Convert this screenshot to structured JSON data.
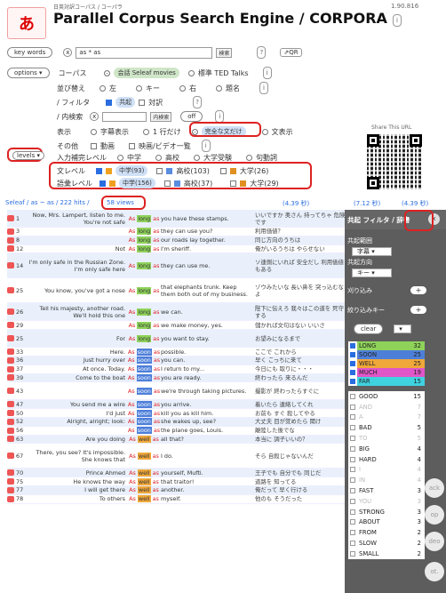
{
  "header": {
    "subtitle": "日英対訳コーパス / コーパラ",
    "title": "Parallel Corpus Search Engine / CORPORA",
    "version": "1.90.816",
    "logo": "あ"
  },
  "search": {
    "keywords_label": "key words",
    "query": "as * as",
    "search_btn": "検索",
    "qr_label": "QR",
    "help": "?",
    "clear": "x"
  },
  "options": {
    "label": "options",
    "corpus_label": "コーパス",
    "corpus_1": "会話 Seleaf movies",
    "corpus_2": "標準 TED Talks",
    "sort_label": "並び替え",
    "sort_opts": [
      "左",
      "キー",
      "右",
      "題名"
    ],
    "filter_label": "/ フィルタ",
    "filter_opts": [
      "共起",
      "対訳"
    ],
    "inner_label": "/ 内検索",
    "inner_btn": "内検索",
    "inner_off": "off",
    "display_label": "表示",
    "display_opts": [
      "字幕表示",
      "1 行だけ",
      "完全な文だけ",
      "文表示"
    ],
    "other_label": "その他",
    "other_opts": [
      "動画",
      "映画/ビデオ一覧"
    ],
    "input_label": "入力補完レベル",
    "input_opts": [
      "中学",
      "高校",
      "大学受験",
      "句動詞"
    ],
    "share": "Share This URL"
  },
  "levels": {
    "label": "levels",
    "sentence_label": "文レベル",
    "word_label": "語彙レベル",
    "sentence": [
      {
        "label": "中学(93)",
        "color": "#f0a020"
      },
      {
        "label": "高校(103)",
        "color": "#5a8ce0"
      },
      {
        "label": "大学(26)",
        "color": "#e09020"
      }
    ],
    "word": [
      {
        "label": "中学(156)",
        "color": "#f0a020"
      },
      {
        "label": "高校(37)",
        "color": "#5a8ce0"
      },
      {
        "label": "大学(29)",
        "color": "#e09020"
      }
    ]
  },
  "stats": {
    "path": "Seleaf / as ~ as / 222 hits / ",
    "views": "58 views",
    "t1": "(4.39 秒)",
    "t2": "(7.12 秒)",
    "t3": "(4.39 秒)"
  },
  "rows": [
    {
      "n": "1",
      "l": "Now, Mrs. Lampert, listen to me. You're not safe",
      "k": "long",
      "cls": "kwon",
      "r": "you have these stamps.",
      "j": "いいですか 奥さん 持ってちゃ 危険です"
    },
    {
      "n": "3",
      "l": "",
      "k": "long",
      "cls": "kwon",
      "r": "they can use you?",
      "j": "利用価値？"
    },
    {
      "n": "8",
      "l": "",
      "k": "long",
      "cls": "kwon",
      "r": "our roads lay together.",
      "j": "同じ方向のうちは"
    },
    {
      "n": "12",
      "l": "Not",
      "k": "long",
      "cls": "kwon",
      "r": "I'm sheriff.",
      "j": "俺がいるうちは やらせない"
    },
    {
      "n": "14",
      "l": "I'm only safe in the Russian Zone. I'm only safe here",
      "k": "long",
      "cls": "kwon",
      "r": "they can use me.",
      "j": "ソ連側にいれば 安全だし 利用価値もある"
    },
    {
      "n": "25",
      "l": "You know, you've got a nose",
      "k": "long",
      "cls": "kwon",
      "r": "that elephants trunk. Keep them both out of my business.",
      "j": "ゾウみたいな 長い鼻を 突っ込むなよ"
    },
    {
      "n": "26",
      "l": "Tell his majesty, another road. We'll hold this one",
      "k": "long",
      "cls": "kwon",
      "r": "we can.",
      "j": "陛下に伝えろ 我々はこの道を 死守する"
    },
    {
      "n": "29",
      "l": "",
      "k": "long",
      "cls": "kwon",
      "r": "we make money, yes.",
      "j": "儲かれば文句はない いいさ"
    },
    {
      "n": "25",
      "l": "For",
      "k": "long",
      "cls": "kwon",
      "r": "you want to stay.",
      "j": "お望みになるまで"
    },
    {
      "n": "33",
      "l": "Here.",
      "k": "soon",
      "cls": "kwsoon",
      "r": "possible.",
      "j": "ここで これから"
    },
    {
      "n": "36",
      "l": "Just hurry over",
      "k": "soon",
      "cls": "kwsoon",
      "r": "you can.",
      "j": "早く こっちに来て"
    },
    {
      "n": "37",
      "l": "At once. Today.",
      "k": "soon",
      "cls": "kwsoon",
      "r": "I return to my...",
      "j": "今日にも 取りに・・・"
    },
    {
      "n": "39",
      "l": "Come to the boat",
      "k": "soon",
      "cls": "kwsoon",
      "r": "you are ready.",
      "j": "終わったら 来るんだ"
    },
    {
      "n": "43",
      "l": "",
      "k": "soon",
      "cls": "kwsoon",
      "r": "we're through taking pictures.",
      "j": "撮影が 終わったらすぐに"
    },
    {
      "n": "47",
      "l": "You send me a wire",
      "k": "soon",
      "cls": "kwsoon",
      "r": "you arrive.",
      "j": "着いたら 連絡してくれ"
    },
    {
      "n": "50",
      "l": "I'd just",
      "k": "soon",
      "cls": "kwsoon",
      "r": "kill you as kill him.",
      "j": "お前も すぐ 殺してやる"
    },
    {
      "n": "52",
      "l": "Alright, alright; look:",
      "k": "soon",
      "cls": "kwsoon",
      "r": "she wakes up, see?",
      "j": "大丈夫 目が覚めたら 聞け"
    },
    {
      "n": "56",
      "l": "",
      "k": "soon",
      "cls": "kwsoon",
      "r": "the plane goes, Louis.",
      "j": "離陸した後でな"
    },
    {
      "n": "63",
      "l": "Are you doing",
      "k": "well",
      "cls": "kwwell",
      "r": "all that?",
      "j": "本当に 調子いいの？"
    },
    {
      "n": "67",
      "l": "There, you see? It's impossible. She knows that",
      "k": "well",
      "cls": "kwwell",
      "r": "I do.",
      "j": "そら 自殺じゃないんだ"
    },
    {
      "n": "70",
      "l": "Prince Ahmed",
      "k": "well",
      "cls": "kwwell",
      "r": "yourself, Mufti.",
      "j": "王子でも 自分でも 同じだ"
    },
    {
      "n": "75",
      "l": "He knows the way",
      "k": "well",
      "cls": "kwwell",
      "r": "that traitor!",
      "j": "道路を 知ってる"
    },
    {
      "n": "77",
      "l": "I will get there",
      "k": "well",
      "cls": "kwwell",
      "r": "another.",
      "j": "俺だって 早く行ける"
    },
    {
      "n": "78",
      "l": "To others",
      "k": "well",
      "cls": "kwwell",
      "r": "myself.",
      "j": "他のも そうだった"
    }
  ],
  "panel": {
    "title": "共起 フィルタ / 辞書",
    "close": "x",
    "range_label": "共起範囲",
    "range_val": "字幕",
    "dir_label": "共起方向",
    "dir_val": "キー",
    "narrow": "刈り込み",
    "narrow_key": "絞り込みキー",
    "clear": "clear",
    "levels": [
      {
        "w": "LONG",
        "n": "32",
        "c": "#8ed25a"
      },
      {
        "w": "SOON",
        "n": "25",
        "c": "#4d7fd9"
      },
      {
        "w": "WELL",
        "n": "25",
        "c": "#f0a83a"
      },
      {
        "w": "MUCH",
        "n": "19",
        "c": "#e056c8"
      },
      {
        "w": "FAR",
        "n": "15",
        "c": "#3fd3e0"
      }
    ],
    "keys": [
      {
        "w": "GOOD",
        "n": "15",
        "g": false
      },
      {
        "w": "AND",
        "n": "7",
        "g": true
      },
      {
        "w": "A",
        "n": "7",
        "g": true
      },
      {
        "w": "BAD",
        "n": "5",
        "g": false
      },
      {
        "w": "TO",
        "n": "5",
        "g": true
      },
      {
        "w": "BIG",
        "n": "4",
        "g": false
      },
      {
        "w": "HARD",
        "n": "4",
        "g": false
      },
      {
        "w": "I",
        "n": "4",
        "g": true
      },
      {
        "w": "IN",
        "n": "4",
        "g": true
      },
      {
        "w": "FAST",
        "n": "3",
        "g": false
      },
      {
        "w": "YOU",
        "n": "3",
        "g": true
      },
      {
        "w": "STRONG",
        "n": "3",
        "g": false
      },
      {
        "w": "ABOUT",
        "n": "3",
        "g": false
      },
      {
        "w": "FROM",
        "n": "2",
        "g": false
      },
      {
        "w": "SLOW",
        "n": "2",
        "g": false
      },
      {
        "w": "SMALL",
        "n": "2",
        "g": false
      }
    ]
  },
  "side": {
    "b1": "ack",
    "b2": "op",
    "b3": "deo",
    "b4": "ot."
  }
}
